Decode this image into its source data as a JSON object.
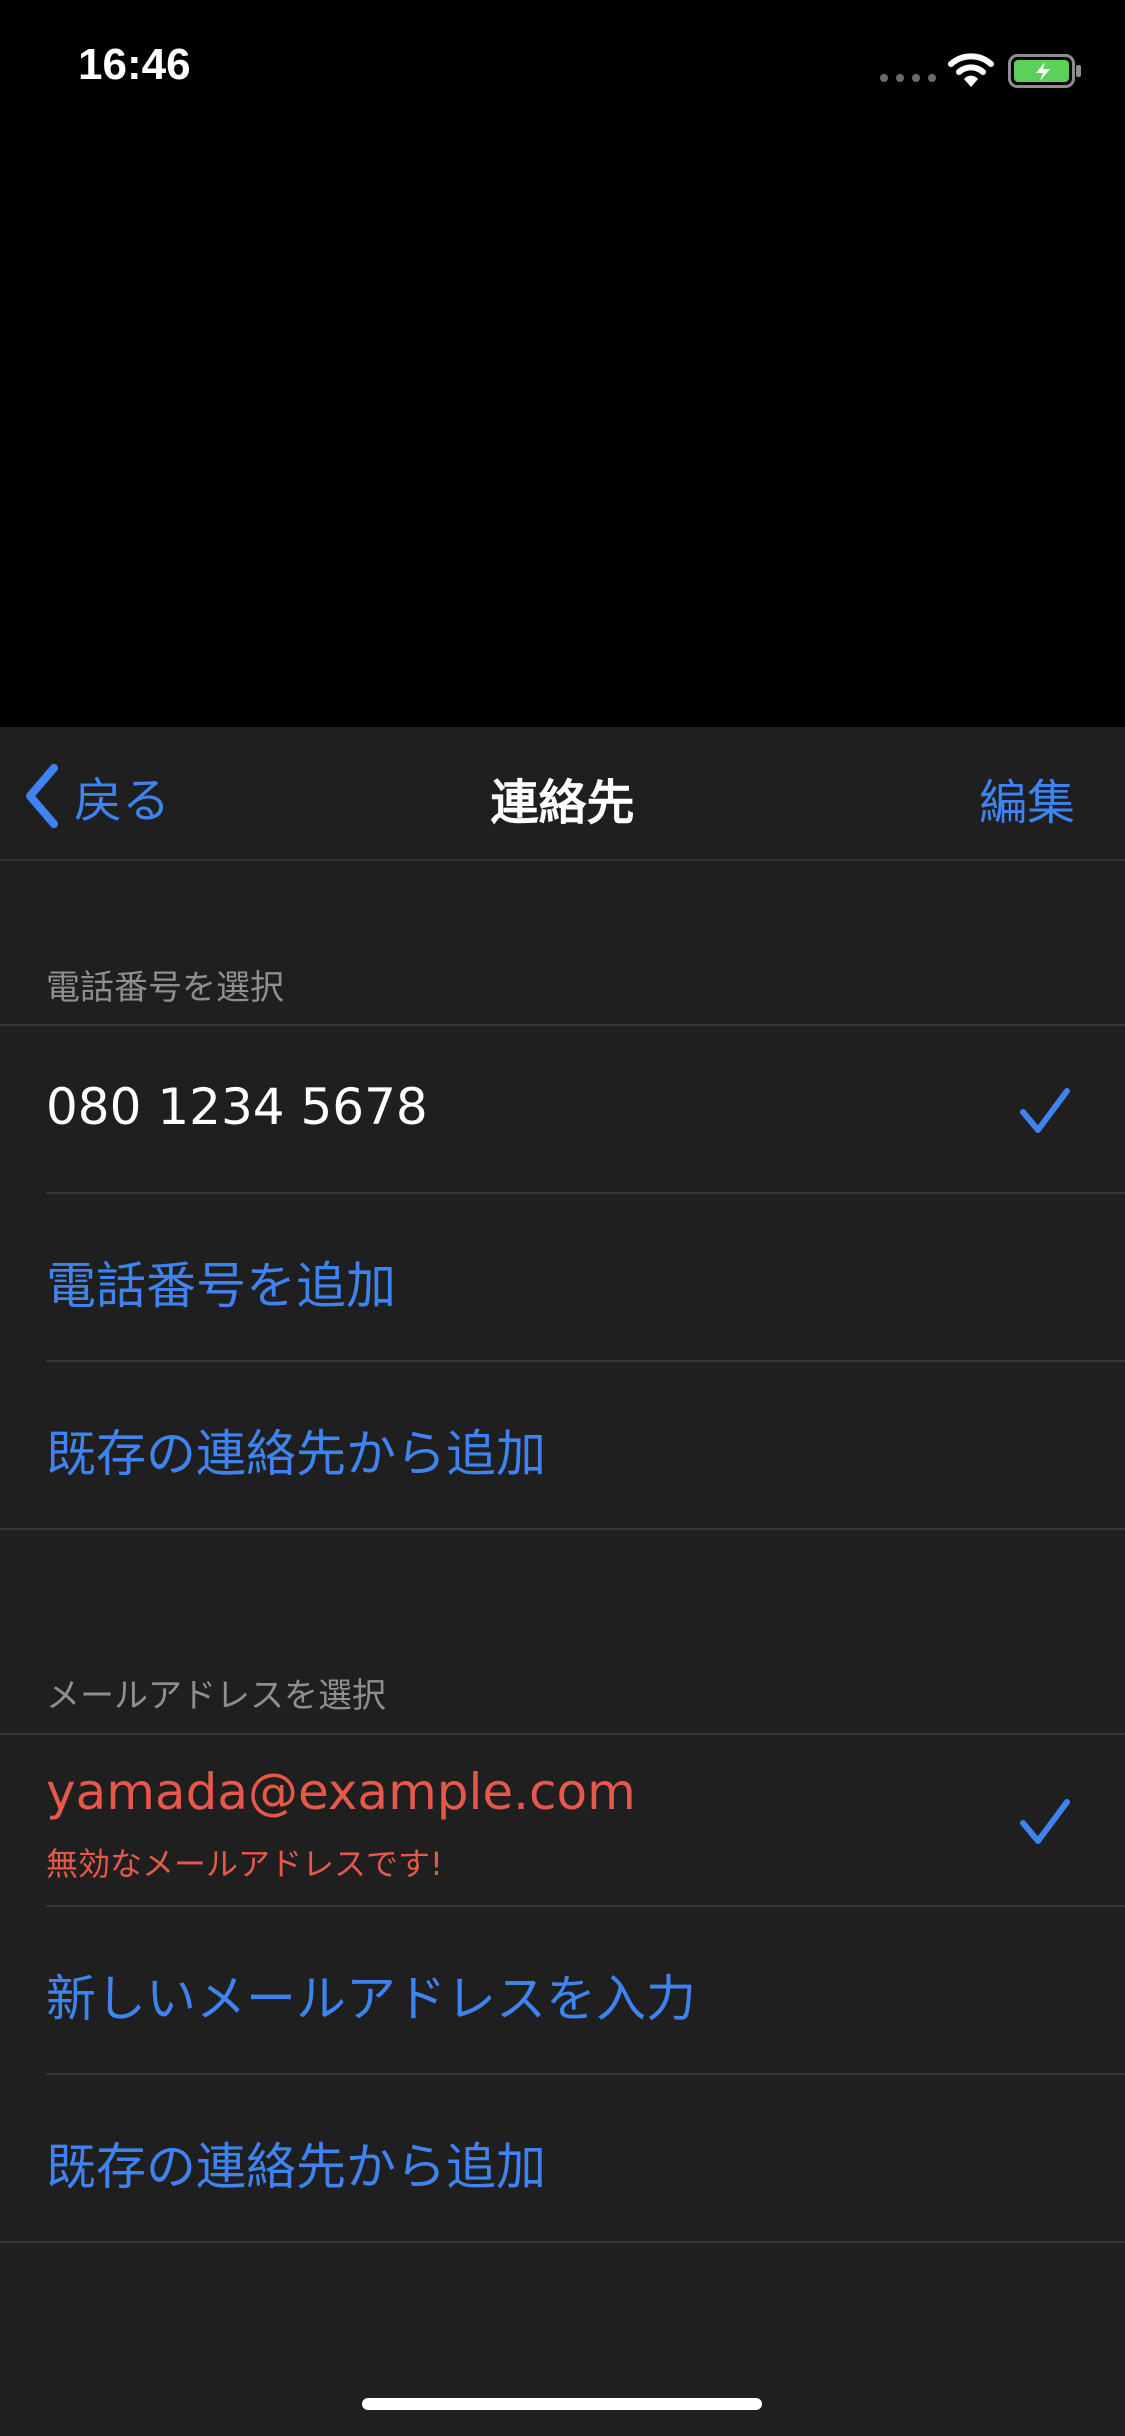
{
  "status_bar": {
    "time": "16:46"
  },
  "nav": {
    "back_label": "戻る",
    "title": "連絡先",
    "edit_label": "編集"
  },
  "phone_section": {
    "header": "電話番号を選択",
    "selected_number": "080 1234 5678",
    "add_phone_label": "電話番号を追加",
    "add_from_contacts_label": "既存の連絡先から追加"
  },
  "email_section": {
    "header": "メールアドレスを選択",
    "selected_email": "yamada@example.com",
    "error_message": "無効なメールアドレスです!",
    "new_email_label": "新しいメールアドレスを入力",
    "add_from_contacts_label": "既存の連絡先から追加"
  },
  "colors": {
    "accent": "#3e83f0",
    "error": "#e5584a",
    "background": "#1f1f1f"
  },
  "icons": [
    "back-chevron-icon",
    "checkmark-icon",
    "wifi-icon",
    "battery-icon",
    "signal-icon"
  ]
}
